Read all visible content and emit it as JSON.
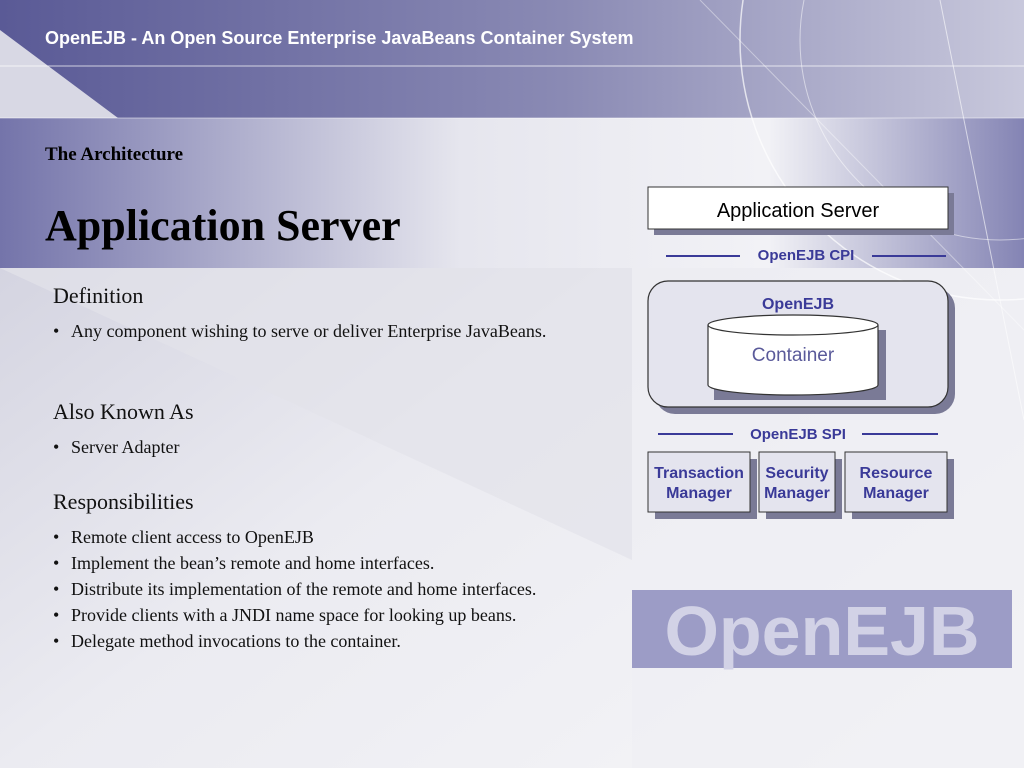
{
  "header": {
    "title": "OpenEJB  -  An Open Source Enterprise JavaBeans Container System"
  },
  "slide": {
    "section": "The Architecture",
    "title": "Application Server"
  },
  "content": {
    "definition": {
      "heading": "Definition",
      "text": "Any component wishing to serve or deliver Enterprise JavaBeans."
    },
    "aka": {
      "heading": "Also Known As",
      "items": [
        "Server Adapter"
      ]
    },
    "responsibilities": {
      "heading": "Responsibilities",
      "items": [
        "Remote client access to OpenEJB",
        "Implement the bean’s remote and home interfaces.",
        "Distribute its implementation of the remote and home interfaces.",
        "Provide clients with a JNDI name space for looking up beans.",
        "Delegate method invocations to the container."
      ]
    }
  },
  "diagram": {
    "app_server": "Application Server",
    "cpi": "OpenEJB CPI",
    "openejb": "OpenEJB",
    "container": "Container",
    "spi": "OpenEJB SPI",
    "managers": [
      {
        "line1": "Transaction",
        "line2": "Manager"
      },
      {
        "line1": "Security",
        "line2": "Manager"
      },
      {
        "line1": "Resource",
        "line2": "Manager"
      }
    ]
  },
  "logo": {
    "text": "OpenEJB"
  },
  "colors": {
    "band": "#6c6ca4",
    "accent": "#3a3a98",
    "box_border": "#333333",
    "box_fill": "#e4e4ee"
  }
}
